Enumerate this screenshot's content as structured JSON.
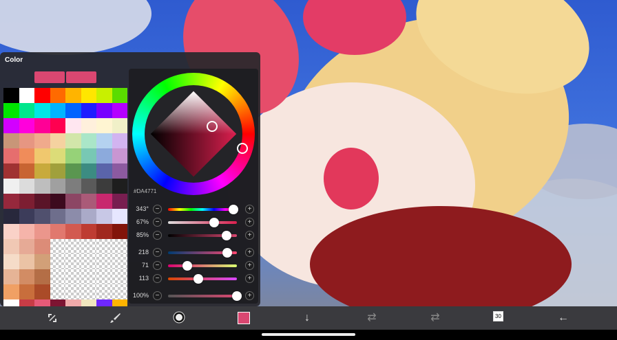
{
  "panel": {
    "title": "Color",
    "current_color": "#DA4771",
    "hex": "#DA4771"
  },
  "palette": [
    "#000000",
    "#ffffff",
    "#ff0000",
    "#ff6a00",
    "#ffb400",
    "#ffe600",
    "#c8f000",
    "#5adc00",
    "#00e600",
    "#00e68c",
    "#00e6e6",
    "#00b4ff",
    "#0064ff",
    "#1e1eff",
    "#7800ff",
    "#b400ff",
    "#d200ff",
    "#ff00dc",
    "#ff0096",
    "#ff0050",
    "#ffe6f0",
    "#fff0dc",
    "#fff5d2",
    "#f0f0c8",
    "#c89678",
    "#e69682",
    "#f0aa8c",
    "#f5d2a0",
    "#d2e6aa",
    "#aae6c8",
    "#b4d2f0",
    "#d2b4f0",
    "#e66e6e",
    "#f08c5a",
    "#f0c86e",
    "#dcdc78",
    "#96d278",
    "#78c8b4",
    "#8caadc",
    "#c896d2",
    "#a03232",
    "#c86432",
    "#c8aa3c",
    "#a0a03c",
    "#5a9650",
    "#3c8c82",
    "#5a64aa",
    "#8c5aa0",
    "#f0f0f0",
    "#dcdcdc",
    "#bebebe",
    "#a0a0a0",
    "#7d7d7d",
    "#5a5a5a",
    "#3c3c3c",
    "#1e1e1e",
    "#96283c",
    "#7d1e32",
    "#5a1428",
    "#3c0a1e",
    "#8c4664",
    "#aa5a78",
    "#c8286e",
    "#781e50",
    "#28283c",
    "#3c3c5a",
    "#50506e",
    "#6e6e8c",
    "#8c8caa",
    "#aaaac8",
    "#c8c8e6",
    "#e6e6ff",
    "#fad2c8",
    "#f5b4aa",
    "#eb968c",
    "#e1786e",
    "#d25a50",
    "#be3c32",
    "#a0281e",
    "#82140a",
    "#f0c8b4",
    "#e6aa96",
    "#dc8c78",
    "#transparent",
    "#transparent",
    "#transparent",
    "#transparent",
    "#transparent",
    "#f5dcc8",
    "#ebc3a5",
    "#d2a078",
    "#transparent",
    "#transparent",
    "#transparent",
    "#transparent",
    "#transparent",
    "#e6b496",
    "#d28c64",
    "#b46e46",
    "#transparent",
    "#transparent",
    "#transparent",
    "#transparent",
    "#transparent",
    "#f0a064",
    "#c86e3c",
    "#aa4b28",
    "#transparent",
    "#transparent",
    "#transparent",
    "#transparent",
    "#transparent",
    "#ffffff",
    "#c83c46",
    "#e65a78",
    "#7d1432",
    "#f0aaaa",
    "#f0e6be",
    "#6e28ff",
    "#ffb400"
  ],
  "sliders": [
    {
      "id": "hue",
      "value": "343°",
      "level": 0.95
    },
    {
      "id": "saturation",
      "value": "67%",
      "level": 0.67
    },
    {
      "id": "brightness",
      "value": "85%",
      "level": 0.85
    },
    {
      "id": "red",
      "value": "218",
      "level": 0.855
    },
    {
      "id": "green",
      "value": "71",
      "level": 0.28
    },
    {
      "id": "blue",
      "value": "113",
      "level": 0.44
    },
    {
      "id": "opacity",
      "value": "100%",
      "level": 1.0
    }
  ],
  "toolbar": {
    "layer_count": "30",
    "brush_size": "1000.0"
  },
  "colors": {
    "toolbar_bg": "#3a3a3e",
    "panel_bg": "#28282c",
    "accent": "#DA4771"
  }
}
